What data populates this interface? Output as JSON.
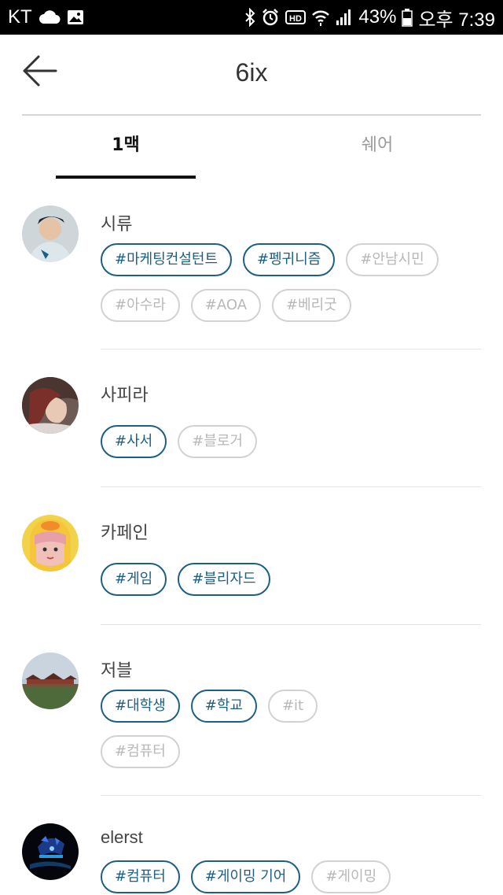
{
  "status_bar": {
    "carrier": "KT",
    "battery": "43%",
    "time": "오후 7:39"
  },
  "header": {
    "title": "6ix"
  },
  "tabs": [
    {
      "label": "1맥",
      "active": true
    },
    {
      "label": "쉐어",
      "active": false
    }
  ],
  "users": [
    {
      "name": "시류",
      "avatar": "person-photo",
      "tags": [
        [
          {
            "label": "#마케팅컨설턴트",
            "on": true
          },
          {
            "label": "#펭귀니즘",
            "on": true
          },
          {
            "label": "#안남시민",
            "on": false
          }
        ],
        [
          {
            "label": "#아수라",
            "on": false
          },
          {
            "label": "#AOA",
            "on": false
          },
          {
            "label": "#베리굿",
            "on": false
          }
        ]
      ]
    },
    {
      "name": "사피라",
      "avatar": "person-photo",
      "tags": [
        [
          {
            "label": "#사서",
            "on": true
          },
          {
            "label": "#블로거",
            "on": false
          }
        ]
      ]
    },
    {
      "name": "카페인",
      "avatar": "character-photo",
      "tags": [
        [
          {
            "label": "#게임",
            "on": true
          },
          {
            "label": "#블리자드",
            "on": true
          }
        ]
      ]
    },
    {
      "name": "저블",
      "avatar": "landscape-photo",
      "tags": [
        [
          {
            "label": "#대학생",
            "on": true
          },
          {
            "label": "#학교",
            "on": true
          },
          {
            "label": "#it",
            "on": false
          }
        ],
        [
          {
            "label": "#컴퓨터",
            "on": false
          }
        ]
      ]
    },
    {
      "name": "elerst",
      "avatar": "night-photo",
      "tags": [
        [
          {
            "label": "#컴퓨터",
            "on": true
          },
          {
            "label": "#게이밍 기어",
            "on": true
          },
          {
            "label": "#게이밍",
            "on": false
          }
        ]
      ]
    }
  ],
  "colors": {
    "accent": "#1d5f84",
    "tag_inactive_border": "#d2d2d2",
    "tag_inactive_text": "#b8b8b8"
  }
}
